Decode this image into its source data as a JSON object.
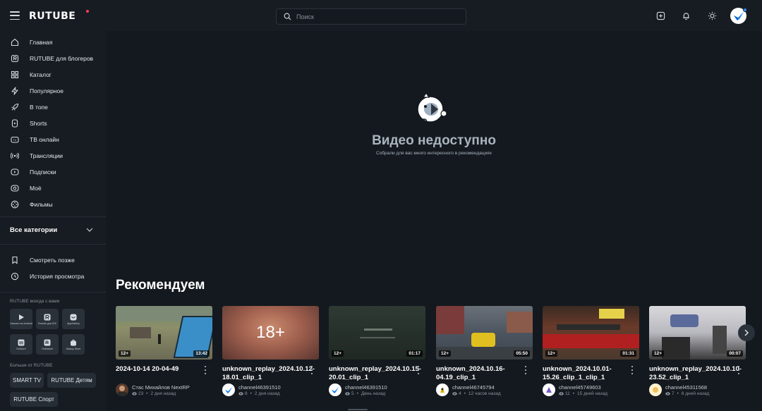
{
  "header": {
    "logo": "RUTUBE",
    "search_placeholder": "Поиск"
  },
  "sidebar": {
    "items": [
      {
        "label": "Главная",
        "icon": "home-icon"
      },
      {
        "label": "RUTUBE для блогеров",
        "icon": "rutube-icon"
      },
      {
        "label": "Каталог",
        "icon": "grid-icon"
      },
      {
        "label": "Популярное",
        "icon": "lightning-icon"
      },
      {
        "label": "В топе",
        "icon": "rocket-icon"
      },
      {
        "label": "Shorts",
        "icon": "shorts-icon"
      },
      {
        "label": "ТВ онлайн",
        "icon": "tv-icon"
      },
      {
        "label": "Трансляции",
        "icon": "broadcast-icon"
      },
      {
        "label": "Подписки",
        "icon": "subscriptions-icon"
      },
      {
        "label": "Моё",
        "icon": "my-icon"
      },
      {
        "label": "Фильмы",
        "icon": "films-icon"
      }
    ],
    "all_categories": "Все категории",
    "library": [
      {
        "label": "Смотреть позже",
        "icon": "bookmark-icon"
      },
      {
        "label": "История просмотра",
        "icon": "history-icon"
      }
    ],
    "apps_title": "RUTUBE всегда с вами",
    "apps": [
      {
        "label": "Скачать на Android"
      },
      {
        "label": "Rutube для iOS"
      },
      {
        "label": "AppGallery"
      },
      {
        "label": "RuStore"
      },
      {
        "label": "RuMarket"
      },
      {
        "label": "Galaxy Store"
      }
    ],
    "more_title": "Больше от RUTUBE",
    "more": [
      "SMART TV",
      "RUTUBE Детям",
      "RUTUBE Спорт"
    ]
  },
  "main": {
    "unavailable_title": "Видео недоступно",
    "unavailable_sub": "Собрали для вас много интересного в рекомендациях",
    "recommend_title": "Рекомендуем",
    "thumb18": "18+",
    "videos": [
      {
        "title": "2024-10-14 20-04-49",
        "channel": "Стас Михайлов NextRP",
        "views": "23",
        "age": "2 дня назад",
        "rating": "12+",
        "duration": "13:42"
      },
      {
        "title": "unknown_replay_2024.10.12-18.01_clip_1",
        "channel": "channel46391510",
        "views": "8",
        "age": "2 дня назад",
        "rating": "",
        "duration": ""
      },
      {
        "title": "unknown_replay_2024.10.15-20.01_clip_1",
        "channel": "channel46391510",
        "views": "5",
        "age": "День назад",
        "rating": "12+",
        "duration": "01:17"
      },
      {
        "title": "unknown_2024.10.16-04.19_clip_1",
        "channel": "channel46745794",
        "views": "4",
        "age": "12 часов назад",
        "rating": "12+",
        "duration": "05:50"
      },
      {
        "title": "unknown_2024.10.01-15.26_clip_1_clip_1",
        "channel": "channel45749603",
        "views": "11",
        "age": "15 дней назад",
        "rating": "12+",
        "duration": "01:31"
      },
      {
        "title": "unknown_replay_2024.10.10-23.52_clip_1",
        "channel": "channel45311568",
        "views": "7",
        "age": "6 дней назад",
        "rating": "12+",
        "duration": "00:07"
      }
    ]
  }
}
